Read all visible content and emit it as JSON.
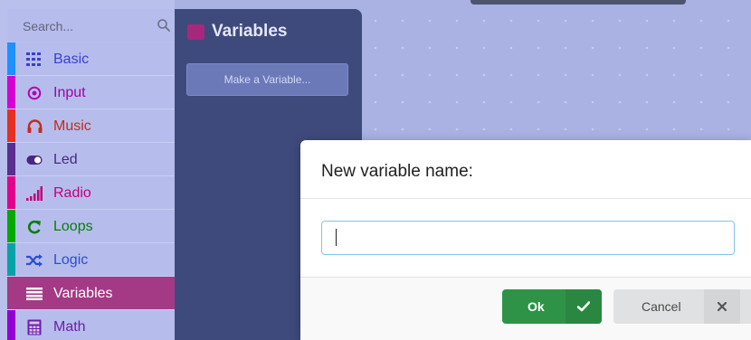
{
  "search": {
    "placeholder": "Search..."
  },
  "categories": [
    {
      "label": "Basic",
      "color": "#1e90ff",
      "icon": "grid-icon",
      "selected": false
    },
    {
      "label": "Input",
      "color": "#d400d4",
      "icon": "target-icon",
      "selected": false
    },
    {
      "label": "Music",
      "color": "#e63022",
      "icon": "headphones-icon",
      "selected": false
    },
    {
      "label": "Led",
      "color": "#5c2d91",
      "icon": "toggle-icon",
      "selected": false
    },
    {
      "label": "Radio",
      "color": "#e3008c",
      "icon": "signal-icon",
      "selected": false
    },
    {
      "label": "Loops",
      "color": "#00aa00",
      "icon": "refresh-icon",
      "selected": false
    },
    {
      "label": "Logic",
      "color": "#00a4a6",
      "icon": "shuffle-icon",
      "selected": false
    },
    {
      "label": "Variables",
      "color": "#dc143c",
      "icon": "list-icon",
      "selected": true
    },
    {
      "label": "Math",
      "color": "#9400d3",
      "icon": "calculator-icon",
      "selected": false
    }
  ],
  "flyout": {
    "title": "Variables",
    "make_variable_label": "Make a Variable..."
  },
  "dialog": {
    "title": "New variable name:",
    "input_value": "",
    "ok_label": "Ok",
    "cancel_label": "Cancel"
  },
  "colors": {
    "category_text": "#3b3fd1",
    "accent_selected": "#a43a86",
    "ok_green": "#2e9347",
    "input_focus_border": "#7fc5ec"
  }
}
